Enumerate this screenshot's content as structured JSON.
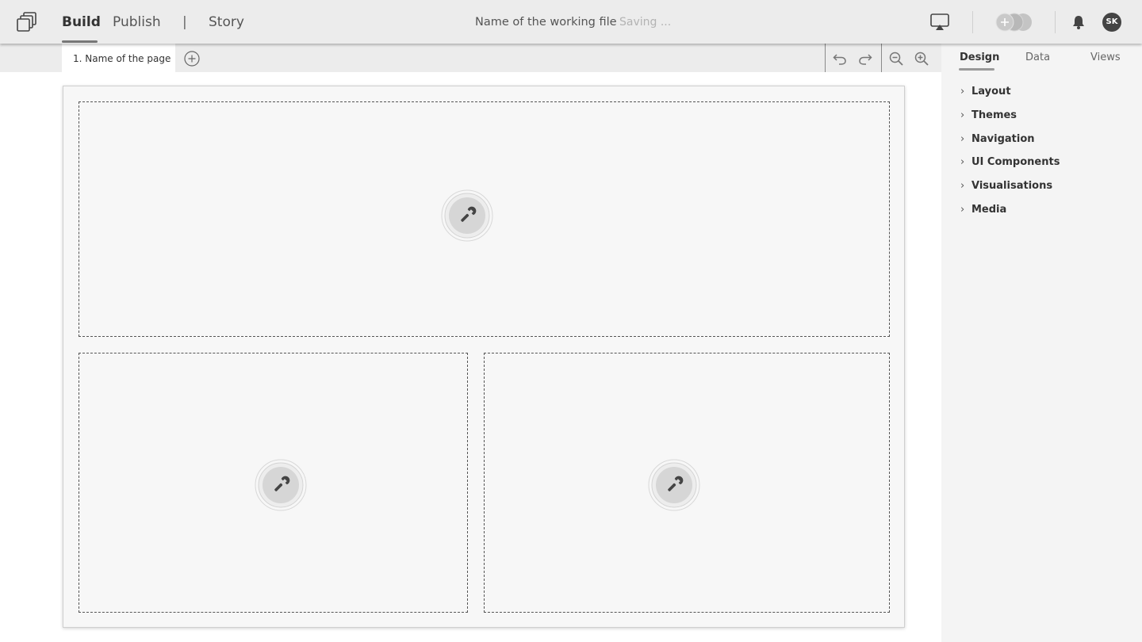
{
  "topbar": {
    "nav": {
      "build": "Build",
      "publish": "Publish",
      "separator": "|",
      "story": "Story"
    },
    "file_name": "Name of the working file",
    "saving_status": "Saving ...",
    "avatar_initials": "SK"
  },
  "pages": {
    "tabs": [
      {
        "label": "1. Name of the page"
      }
    ]
  },
  "panel": {
    "tabs": {
      "design": "Design",
      "data": "Data",
      "views": "Views"
    },
    "sections": [
      "Layout",
      "Themes",
      "Navigation",
      "UI Components",
      "Visualisations",
      "Media"
    ]
  },
  "icons": {
    "logo": "stacked-pages-icon",
    "present": "present-screen-icon",
    "toggle": "add-collaborator-toggle",
    "notifications": "bell-icon",
    "add_page": "plus-circle-icon",
    "undo": "undo-icon",
    "redo": "redo-icon",
    "zoom_out": "zoom-out-icon",
    "zoom_in": "zoom-in-icon",
    "widget": "wrench-icon"
  }
}
